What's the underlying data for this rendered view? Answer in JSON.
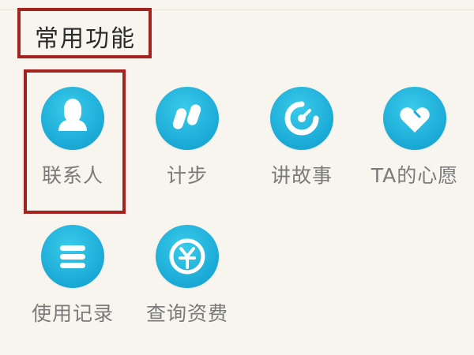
{
  "section": {
    "title": "常用功能"
  },
  "features": [
    {
      "label": "联系人",
      "icon": "person-icon"
    },
    {
      "label": "计步",
      "icon": "footsteps-icon"
    },
    {
      "label": "讲故事",
      "icon": "dial-icon"
    },
    {
      "label": "TA的心愿",
      "icon": "heart-icon"
    },
    {
      "label": "使用记录",
      "icon": "list-icon"
    },
    {
      "label": "查询资费",
      "icon": "coin-icon"
    }
  ],
  "colors": {
    "background": "#f7f5ee",
    "icon_blue": "#1aa9d6",
    "highlight_red": "#a3231f",
    "label_gray": "#7a7a7a"
  }
}
